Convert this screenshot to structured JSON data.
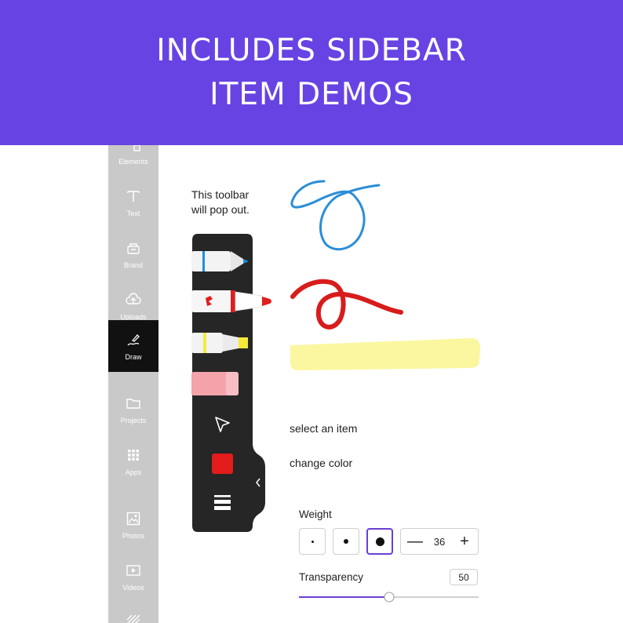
{
  "banner": {
    "line1": "INCLUDES SIDEBAR",
    "line2": "ITEM DEMOS",
    "bg_color": "#6743e3"
  },
  "sidebar": {
    "items": [
      {
        "label": "Elements",
        "icon": "elements-icon"
      },
      {
        "label": "Text",
        "icon": "text-icon"
      },
      {
        "label": "Brand",
        "icon": "brand-icon"
      },
      {
        "label": "Uploads",
        "icon": "upload-cloud-icon"
      },
      {
        "label": "Draw",
        "icon": "draw-icon",
        "active": true
      },
      {
        "label": "Projects",
        "icon": "folder-icon"
      },
      {
        "label": "Apps",
        "icon": "apps-grid-icon"
      },
      {
        "label": "Photos",
        "icon": "photo-icon"
      },
      {
        "label": "Videos",
        "icon": "video-icon"
      },
      {
        "label": "",
        "icon": "pattern-icon"
      }
    ]
  },
  "notes": {
    "toolbar_note_line1": "This toolbar",
    "toolbar_note_line2": "will pop out.",
    "select_item": "select an item",
    "change_color": "change color"
  },
  "toolbar": {
    "tools": [
      "pen-icon",
      "marker-icon",
      "highlighter-icon",
      "eraser-icon",
      "select-arrow-icon",
      "color-swatch",
      "menu-icon"
    ],
    "collapse_icon": "chevron-left-icon",
    "pen_color": "#1f8fe0",
    "marker_color": "#e01e1e",
    "highlighter_color": "#f5ea3a",
    "swatch_color": "#e31b1b"
  },
  "weight": {
    "label": "Weight",
    "selected_index": 2,
    "value": "36",
    "minus": "—",
    "plus": "+"
  },
  "transparency": {
    "label": "Transparency",
    "value": "50",
    "fraction": 0.5
  },
  "accent_color": "#6a3fd6"
}
